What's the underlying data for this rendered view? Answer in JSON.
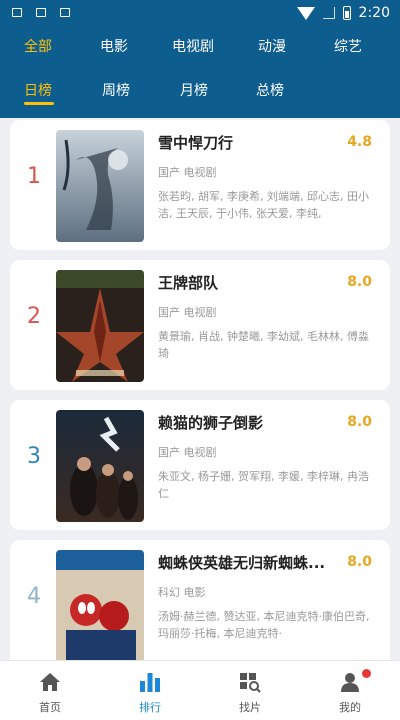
{
  "status_bar": {
    "time": "2:20"
  },
  "category_tabs": [
    {
      "label": "全部",
      "active": true
    },
    {
      "label": "电影",
      "active": false
    },
    {
      "label": "电视剧",
      "active": false
    },
    {
      "label": "动漫",
      "active": false
    },
    {
      "label": "综艺",
      "active": false
    }
  ],
  "period_tabs": [
    {
      "label": "日榜",
      "active": true
    },
    {
      "label": "周榜",
      "active": false
    },
    {
      "label": "月榜",
      "active": false
    },
    {
      "label": "总榜",
      "active": false
    }
  ],
  "rankings": [
    {
      "rank": "1",
      "rank_color": "#d9534f",
      "title": "雪中悍刀行",
      "score": "4.8",
      "genre": "国产 电视剧",
      "cast": "张若昀, 胡军, 李庚希, 刘端端, 邱心志, 田小洁, 王天辰, 于小伟, 张天爱, 李纯,",
      "poster_icon": "poster-snow-swordsman"
    },
    {
      "rank": "2",
      "rank_color": "#d9534f",
      "title": "王牌部队",
      "score": "8.0",
      "genre": "国产 电视剧",
      "cast": "黄景瑜, 肖战, 钟楚曦, 李幼斌, 毛林林, 傅淼琦",
      "poster_icon": "poster-ace-troops"
    },
    {
      "rank": "3",
      "rank_color": "#2e86b7",
      "title": "赖猫的狮子倒影",
      "score": "8.0",
      "genre": "国产 电视剧",
      "cast": "朱亚文, 杨子姗, 贺军翔, 李媛, 李梓琳, 冉浩仁",
      "poster_icon": "poster-cat-lion"
    },
    {
      "rank": "4",
      "rank_color": "#8fb4d0",
      "title": "蜘蛛侠英雄无归新蜘蛛...",
      "score": "8.0",
      "genre": "科幻 电影",
      "cast": "汤姆·赫兰德, 赞达亚, 本尼迪克特·康伯巴奇, 玛丽莎·托梅, 本尼迪克特·",
      "poster_icon": "poster-spider-man"
    }
  ],
  "bottom_nav": [
    {
      "label": "首页",
      "icon": "home-icon",
      "active": false
    },
    {
      "label": "排行",
      "icon": "ranking-icon",
      "active": true
    },
    {
      "label": "找片",
      "icon": "find-icon",
      "active": false
    },
    {
      "label": "我的",
      "icon": "profile-icon",
      "active": false
    }
  ],
  "colors": {
    "header": "#0e5d8f",
    "accent": "#ffc107",
    "score": "#e7a722",
    "nav_active": "#1e88d6"
  }
}
